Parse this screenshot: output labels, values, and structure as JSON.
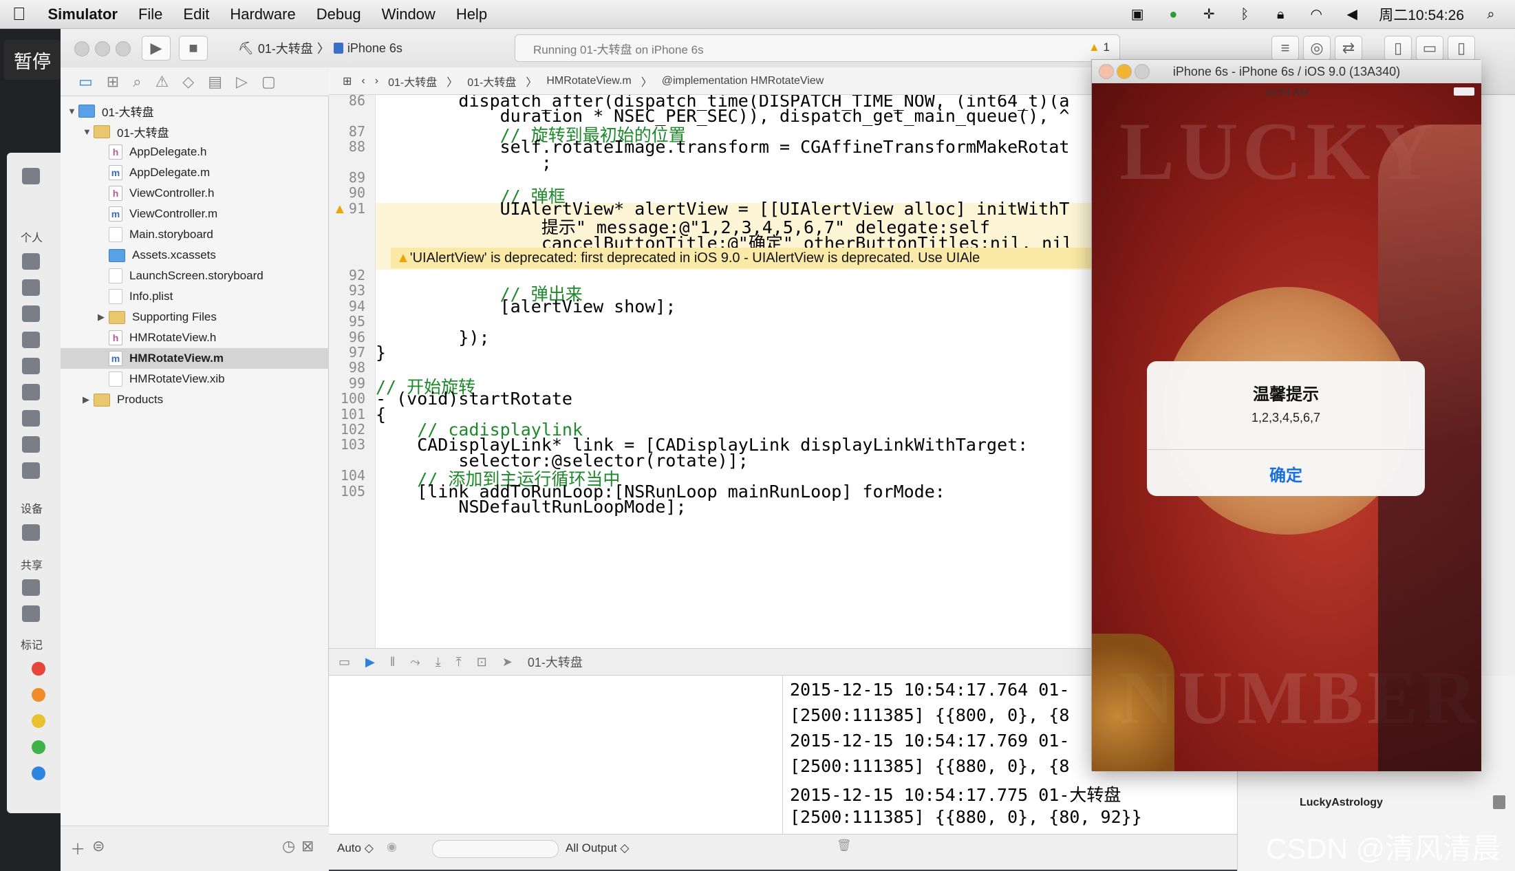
{
  "menubar": {
    "app": "Simulator",
    "menus": [
      "File",
      "Edit",
      "Hardware",
      "Debug",
      "Window",
      "Help"
    ],
    "clock": "周二10:54:26"
  },
  "overlay": {
    "pause_label": "暂停"
  },
  "left_panel": {
    "labels": [
      "个人",
      "设备",
      "共享",
      "标记"
    ]
  },
  "toolbar": {
    "scheme": "01-大转盘",
    "device": "iPhone 6s",
    "activity": "Running 01-大转盘 on iPhone 6s",
    "warning_count": "1"
  },
  "navigator": {
    "items": [
      {
        "name": "01-大转盘",
        "kind": "project",
        "indent": 0
      },
      {
        "name": "01-大转盘",
        "kind": "folder",
        "indent": 1
      },
      {
        "name": "AppDelegate.h",
        "kind": "h",
        "indent": 2
      },
      {
        "name": "AppDelegate.m",
        "kind": "m",
        "indent": 2
      },
      {
        "name": "ViewController.h",
        "kind": "h",
        "indent": 2
      },
      {
        "name": "ViewController.m",
        "kind": "m",
        "indent": 2
      },
      {
        "name": "Main.storyboard",
        "kind": "storyboard",
        "indent": 2
      },
      {
        "name": "Assets.xcassets",
        "kind": "assets",
        "indent": 2
      },
      {
        "name": "LaunchScreen.storyboard",
        "kind": "storyboard",
        "indent": 2
      },
      {
        "name": "Info.plist",
        "kind": "plist",
        "indent": 2
      },
      {
        "name": "Supporting Files",
        "kind": "folder",
        "indent": 2
      },
      {
        "name": "HMRotateView.h",
        "kind": "h",
        "indent": 2
      },
      {
        "name": "HMRotateView.m",
        "kind": "m",
        "indent": 2,
        "selected": true
      },
      {
        "name": "HMRotateView.xib",
        "kind": "xib",
        "indent": 2
      },
      {
        "name": "Products",
        "kind": "folder",
        "indent": 1
      }
    ]
  },
  "jumpbar": {
    "crumbs": [
      "01-大转盘",
      "01-大转盘",
      "HMRotateView.m",
      "@implementation HMRotateView"
    ]
  },
  "editor": {
    "line_numbers": [
      "86",
      "",
      "87",
      "88",
      "",
      "89",
      "90",
      "91",
      "",
      "",
      "92",
      "93",
      "94",
      "95",
      "96",
      "97",
      "98",
      "99",
      "100",
      "101",
      "102",
      "103",
      "",
      "104",
      "105"
    ],
    "lines": [
      "        dispatch_after(dispatch_time(DISPATCH_TIME_NOW, (int64_t)(a",
      "            duration * NSEC_PER_SEC)), dispatch_get_main_queue(), ^",
      "            // 旋转到最初始的位置",
      "            self.rotateImage.transform = CGAffineTransformMakeRotat",
      "                ;",
      "",
      "            // 弹框",
      "            UIAlertView* alertView = [[UIAlertView alloc] initWithT",
      "                提示\" message:@\"1,2,3,4,5,6,7\" delegate:self",
      "                cancelButtonTitle:@\"确定\" otherButtonTitles:nil, nil",
      "",
      "            // 弹出来",
      "            [alertView show];",
      "",
      "        });",
      "}",
      "",
      "// 开始旋转",
      "- (void)startRotate",
      "{",
      "    // cadisplaylink",
      "    CADisplayLink* link = [CADisplayLink displayLinkWithTarget:",
      "        selector:@selector(rotate)];",
      "    // 添加到主运行循环当中",
      "    [link addToRunLoop:[NSRunLoop mainRunLoop] forMode:",
      "        NSDefaultRunLoopMode];"
    ],
    "warning": "'UIAlertView' is deprecated: first deprecated in iOS 9.0 - UIAlertView is deprecated. Use UIAle"
  },
  "debugbar": {
    "target": "01-大转盘"
  },
  "console": {
    "lines": [
      "2015-12-15 10:54:17.764 01-",
      "[2500:111385] {{800, 0}, {8",
      "2015-12-15 10:54:17.769 01-",
      "[2500:111385] {{880, 0}, {8",
      "2015-12-15 10:54:17.775 01-大转盘",
      "[2500:111385] {{880, 0}, {80, 92}}"
    ]
  },
  "bottom": {
    "auto": "Auto ◇",
    "output": "All Output ◇"
  },
  "right_panel": {
    "item": "LuckyAstrology"
  },
  "watermark": "CSDN @清风清晨",
  "simulator": {
    "title": "iPhone 6s - iPhone 6s / iOS 9.0 (13A340)",
    "time": "10:54 AM",
    "alert": {
      "title": "温馨提示",
      "message": "1,2,3,4,5,6,7",
      "button": "确定"
    }
  }
}
